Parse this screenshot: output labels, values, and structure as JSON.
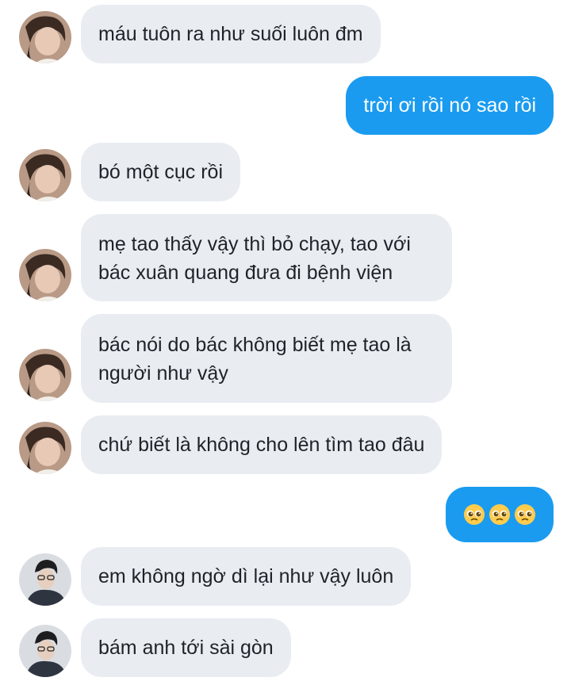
{
  "messages": [
    {
      "side": "in",
      "avatar": "a",
      "lines": [
        "máu tuôn ra như suối luôn đm"
      ]
    },
    {
      "side": "out",
      "lines": [
        "trời ơi rồi nó sao rồi"
      ]
    },
    {
      "side": "in",
      "avatar": "a",
      "lines": [
        "bó một cục rồi"
      ]
    },
    {
      "side": "in",
      "avatar": "a",
      "lines": [
        "mẹ tao thấy vậy thì bỏ chạy, tao với",
        "bác xuân quang đưa đi bệnh viện"
      ]
    },
    {
      "side": "in",
      "avatar": "a",
      "lines": [
        "bác nói do bác không biết mẹ tao là",
        "người như vậy"
      ]
    },
    {
      "side": "in",
      "avatar": "a",
      "lines": [
        "chứ biết là không cho lên tìm tao đâu"
      ]
    },
    {
      "side": "out",
      "emoji": [
        "pleading-face",
        "pleading-face",
        "pleading-face"
      ]
    },
    {
      "side": "in",
      "avatar": "b",
      "lines": [
        "em không ngờ dì lại như vậy luôn"
      ]
    },
    {
      "side": "in",
      "avatar": "b",
      "lines": [
        "bám anh tới sài gòn"
      ]
    }
  ],
  "colors": {
    "incoming_bubble": "#e9ecf1",
    "outgoing_bubble": "#1a9bf0",
    "incoming_text": "#1f2329",
    "outgoing_text": "#ffffff"
  }
}
